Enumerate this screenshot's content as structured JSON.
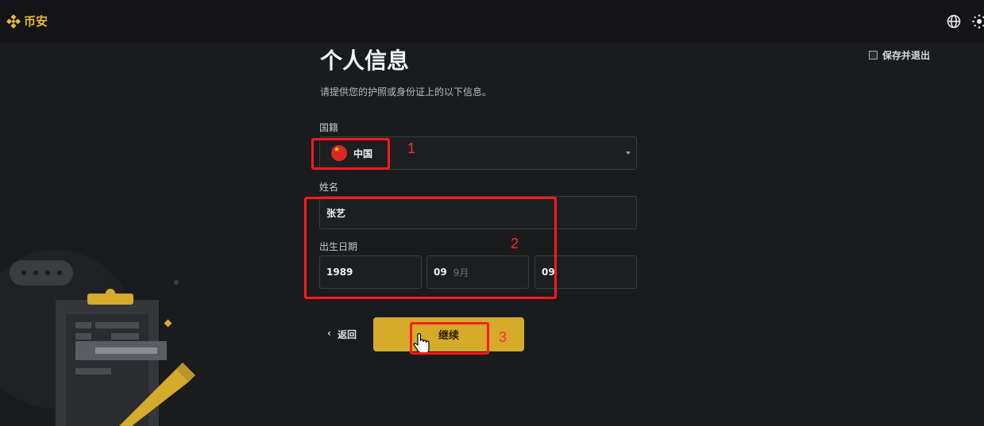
{
  "topbar": {
    "brand": "币安",
    "icons": [
      "binance-logo-icon",
      "globe-icon",
      "theme-icon"
    ]
  },
  "header": {
    "save_exit_label": "保存并退出",
    "title": "个人信息",
    "subtitle": "请提供您的护照或身份证上的以下信息。"
  },
  "form": {
    "nationality_label": "国籍",
    "nationality_value": "中国",
    "name_label": "姓名",
    "name_value": "张艺",
    "dob_label": "出生日期",
    "dob_year": "1989",
    "dob_month": "09",
    "dob_month_unit": "9月",
    "dob_day": "09"
  },
  "actions": {
    "back_label": "返回",
    "back_chevron": "‹",
    "continue_label": "继续"
  },
  "annotations": {
    "label_1": "1",
    "label_2": "2",
    "label_3": "3",
    "color": "#ff1a1a"
  },
  "colors": {
    "accent": "#d4ab2b",
    "background": "#1a1b1d"
  }
}
